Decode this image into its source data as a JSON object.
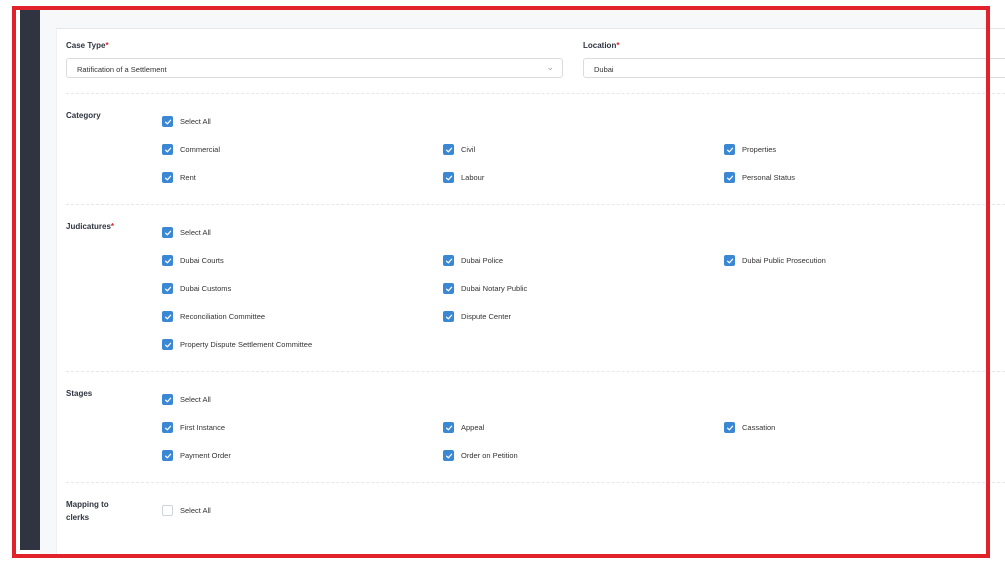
{
  "form": {
    "case_type": {
      "label": "Case Type",
      "required_mark": "*",
      "value": "Ratification of a Settlement"
    },
    "location": {
      "label": "Location",
      "required_mark": "*",
      "value": "Dubai"
    }
  },
  "sections": {
    "category": {
      "title": "Category",
      "select_all": {
        "label": "Select All",
        "checked": true
      },
      "options": [
        {
          "label": "Commercial",
          "checked": true
        },
        {
          "label": "Civil",
          "checked": true
        },
        {
          "label": "Properties",
          "checked": true
        },
        {
          "label": "Rent",
          "checked": true
        },
        {
          "label": "Labour",
          "checked": true
        },
        {
          "label": "Personal Status",
          "checked": true
        }
      ]
    },
    "judicatures": {
      "title": "Judicatures",
      "required_mark": "*",
      "select_all": {
        "label": "Select All",
        "checked": true
      },
      "options": [
        {
          "label": "Dubai Courts",
          "checked": true
        },
        {
          "label": "Dubai Police",
          "checked": true
        },
        {
          "label": "Dubai Public Prosecution",
          "checked": true
        },
        {
          "label": "Dubai Customs",
          "checked": true
        },
        {
          "label": "Dubai Notary Public",
          "checked": true
        },
        {
          "label": "Reconciliation Committee",
          "checked": true
        },
        {
          "label": "Dispute Center",
          "checked": true
        },
        {
          "label": "Property Dispute Settlement Committee",
          "checked": true
        }
      ]
    },
    "stages": {
      "title": "Stages",
      "select_all": {
        "label": "Select All",
        "checked": true
      },
      "options": [
        {
          "label": "First Instance",
          "checked": true
        },
        {
          "label": "Appeal",
          "checked": true
        },
        {
          "label": "Cassation",
          "checked": true
        },
        {
          "label": "Payment Order",
          "checked": true
        },
        {
          "label": "Order on Petition",
          "checked": true
        }
      ]
    },
    "mapping": {
      "title": "Mapping to clerks",
      "select_all": {
        "label": "Select All",
        "checked": false
      }
    }
  },
  "colors": {
    "accent": "#3a87d4",
    "required": "#e1222b",
    "highlight_border": "#e1222b",
    "sidebar": "#2f3440"
  }
}
